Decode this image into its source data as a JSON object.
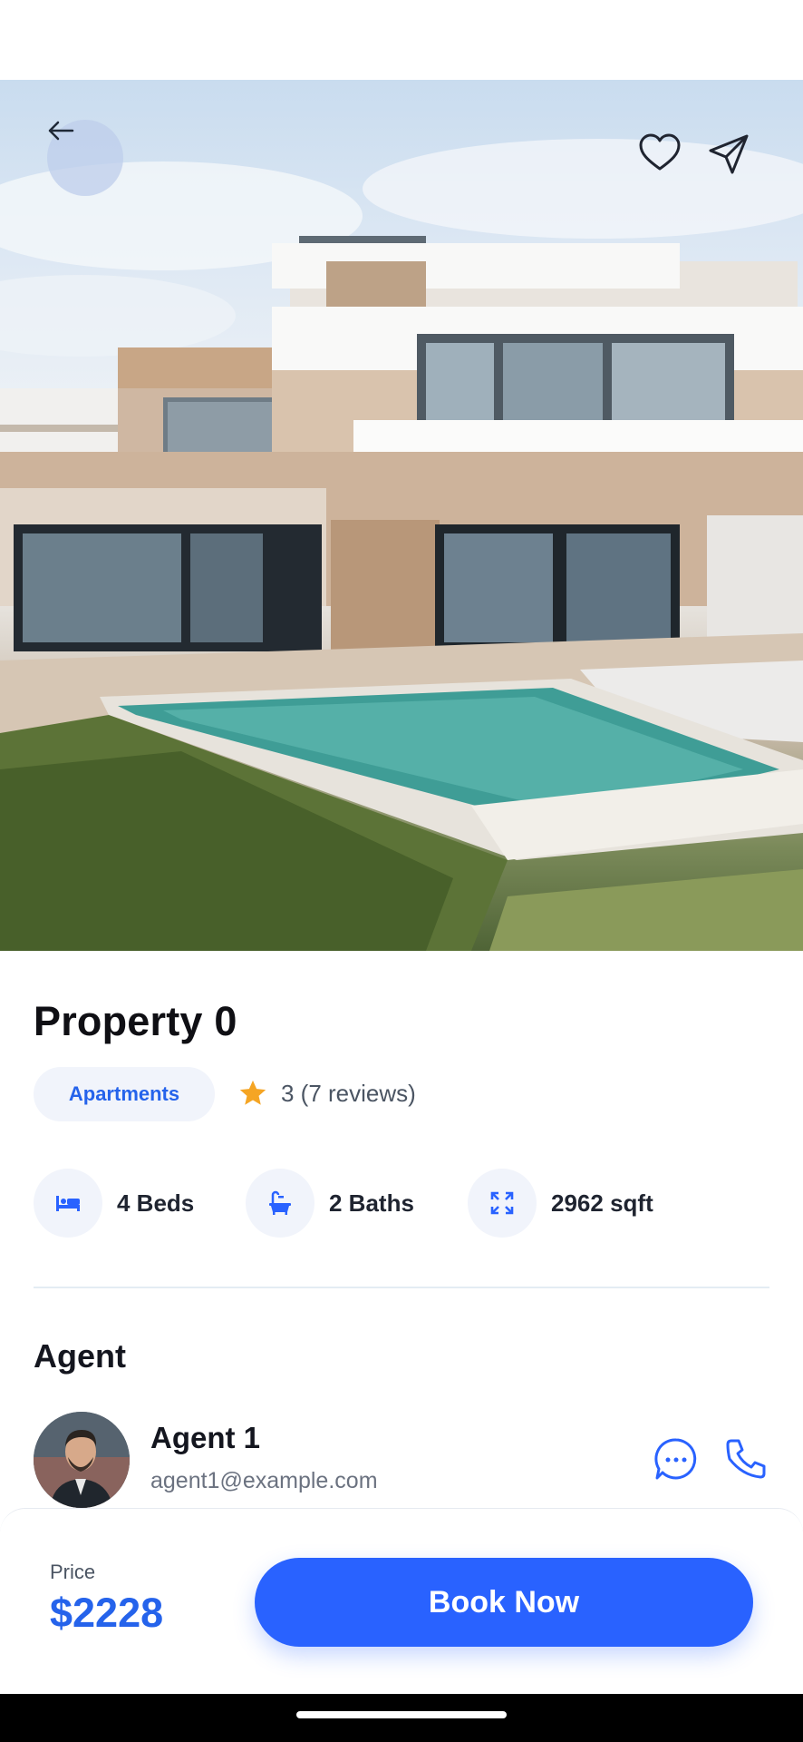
{
  "property": {
    "title": "Property 0",
    "category": "Apartments",
    "rating_text": "3 (7 reviews)",
    "features": [
      {
        "label": "4 Beds",
        "icon": "bed-icon"
      },
      {
        "label": "2 Baths",
        "icon": "bathtub-icon"
      },
      {
        "label": "2962 sqft",
        "icon": "area-expand-icon"
      }
    ]
  },
  "agent_section": {
    "title": "Agent",
    "name": "Agent 1",
    "email": "agent1@example.com"
  },
  "booking": {
    "price_label": "Price",
    "price_value": "$2228",
    "button_label": "Book Now"
  },
  "colors": {
    "accent": "#2962ff",
    "price": "#2563eb",
    "star": "#f5a524"
  }
}
